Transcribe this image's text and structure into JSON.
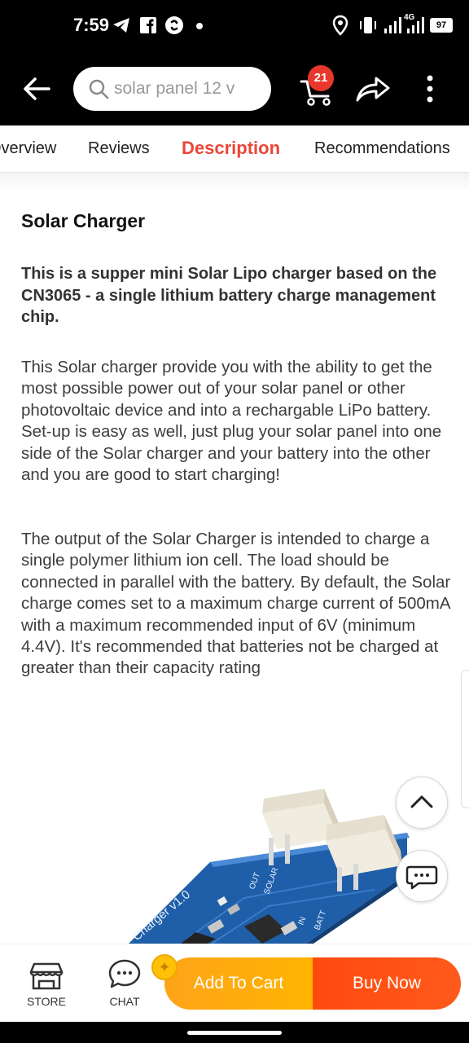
{
  "status_bar": {
    "time": "7:59",
    "battery": "97",
    "network": "4G"
  },
  "header": {
    "search_placeholder": "solar panel 12 v",
    "cart_count": "21"
  },
  "tabs": [
    {
      "label": "Overview"
    },
    {
      "label": "Reviews"
    },
    {
      "label": "Description",
      "active": true
    },
    {
      "label": "Recommendations"
    }
  ],
  "description": {
    "title": "Solar Charger",
    "lead": "This is a supper mini Solar Lipo charger based on the CN3065 - a single lithium battery charge management chip.",
    "paragraphs": [
      "This Solar charger provide you with the ability to get the most possible power out of your solar panel or other photovoltaic device and into a rechargable LiPo battery. Set-up is easy as well, just plug your solar panel into one side of the Solar charger and your battery into the other and you are good to start charging!",
      "The output of the Solar Charger is intended to charge a single polymer lithium ion cell. The load should be connected in parallel with the battery. By default, the Solar charge comes set to a maximum charge current of 500mA with a maximum recommended input of 6V (minimum 4.4V). It's recommended that batteries not be charged at greater than their capacity rating"
    ]
  },
  "product_image": {
    "board_label": "Charger v1.0",
    "pin_labels": [
      "OUT",
      "SOLAR",
      "IN",
      "BATT"
    ]
  },
  "bottom_bar": {
    "store_label": "STORE",
    "chat_label": "CHAT",
    "add_to_cart_label": "Add To Cart",
    "buy_now_label": "Buy Now"
  },
  "colors": {
    "accent_red": "#e9473a",
    "cart_orange": "#ffa31a",
    "buy_orange": "#ff4a0e",
    "badge_red": "#e8372b"
  },
  "icons": {
    "back": "arrow-left-icon",
    "search": "search-icon",
    "cart": "cart-icon",
    "share": "share-icon",
    "more": "more-vertical-icon",
    "store": "store-icon",
    "chat": "chat-icon",
    "scroll_top": "chevron-up-icon",
    "chat_float": "chat-bubble-icon"
  }
}
